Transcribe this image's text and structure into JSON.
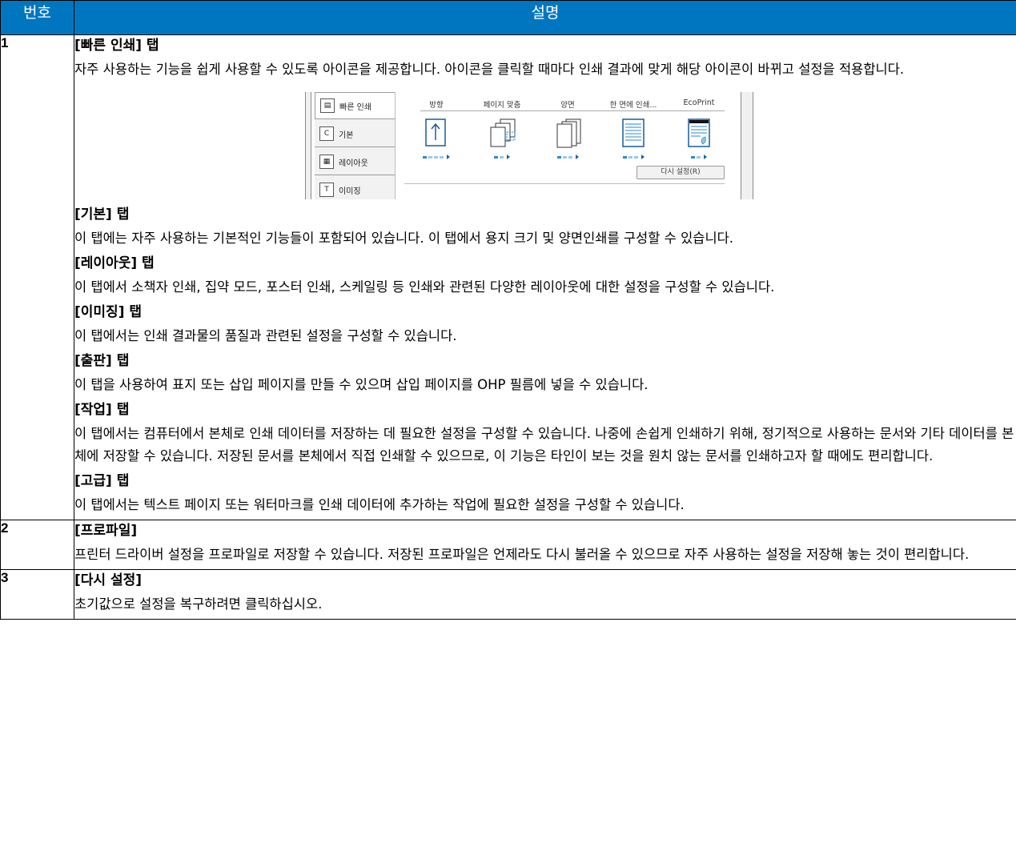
{
  "header": {
    "col_number": "번호",
    "col_description": "설명"
  },
  "rows": [
    {
      "number": "1",
      "sections": [
        {
          "title": "[빠른 인쇄] 탭",
          "text": "자주 사용하는 기능을 쉽게 사용할 수 있도록 아이콘을 제공합니다. 아이콘을 클릭할 때마다 인쇄 결과에 맞게 해당 아이콘이 바뀌고 설정을 적용합니다."
        },
        {
          "title": "[기본] 탭",
          "text": "이 탭에는 자주 사용하는 기본적인 기능들이 포함되어 있습니다. 이 탭에서 용지 크기 및 양면인쇄를 구성할 수 있습니다."
        },
        {
          "title": "[레이아웃] 탭",
          "text": "이 탭에서 소책자 인쇄, 집약 모드, 포스터 인쇄, 스케일링 등 인쇄와 관련된 다양한 레이아웃에 대한 설정을 구성할 수 있습니다."
        },
        {
          "title": "[이미징] 탭",
          "text": "이 탭에서는 인쇄 결과물의 품질과 관련된 설정을 구성할 수 있습니다."
        },
        {
          "title": "[출판] 탭",
          "text": "이 탭을 사용하여 표지 또는 삽입 페이지를 만들 수 있으며 삽입 페이지를 OHP 필름에 넣을 수 있습니다."
        },
        {
          "title": "[작업] 탭",
          "text": "이 탭에서는 컴퓨터에서 본체로 인쇄 데이터를 저장하는 데 필요한 설정을 구성할 수 있습니다. 나중에 손쉽게 인쇄하기 위해, 정기적으로 사용하는 문서와 기타 데이터를 본체에 저장할 수 있습니다. 저장된 문서를 본체에서 직접 인쇄할 수 있으므로, 이 기능은 타인이 보는 것을 원치 않는 문서를 인쇄하고자 할 때에도 편리합니다."
        },
        {
          "title": "[고급] 탭",
          "text": "이 탭에서는 텍스트 페이지 또는 워터마크를 인쇄 데이터에 추가하는 작업에 필요한 설정을 구성할 수 있습니다."
        }
      ]
    },
    {
      "number": "2",
      "sections": [
        {
          "title": "[프로파일]",
          "text": "프린터 드라이버 설정을 프로파일로 저장할 수 있습니다. 저장된 프로파일은 언제라도 다시 불러올 수 있으므로 자주 사용하는 설정을 저장해 놓는 것이 편리합니다."
        }
      ]
    },
    {
      "number": "3",
      "sections": [
        {
          "title": "[다시 설정]",
          "text": "초기값으로 설정을 복구하려면 클릭하십시오."
        }
      ]
    }
  ],
  "screenshot": {
    "sidebar_tabs": [
      {
        "label": "빠른 인쇄",
        "icon": "quick-print-icon",
        "glyph": "▤"
      },
      {
        "label": "기본",
        "icon": "basic-icon",
        "glyph": "C"
      },
      {
        "label": "레이아웃",
        "icon": "layout-icon",
        "glyph": "▦"
      },
      {
        "label": "이미징",
        "icon": "imaging-icon",
        "glyph": "T"
      }
    ],
    "columns": [
      "방향",
      "페이지 맞춤",
      "양면",
      "한 면에 인쇄...",
      "EcoPrint"
    ],
    "reset_button": "다시 설정(R)"
  }
}
